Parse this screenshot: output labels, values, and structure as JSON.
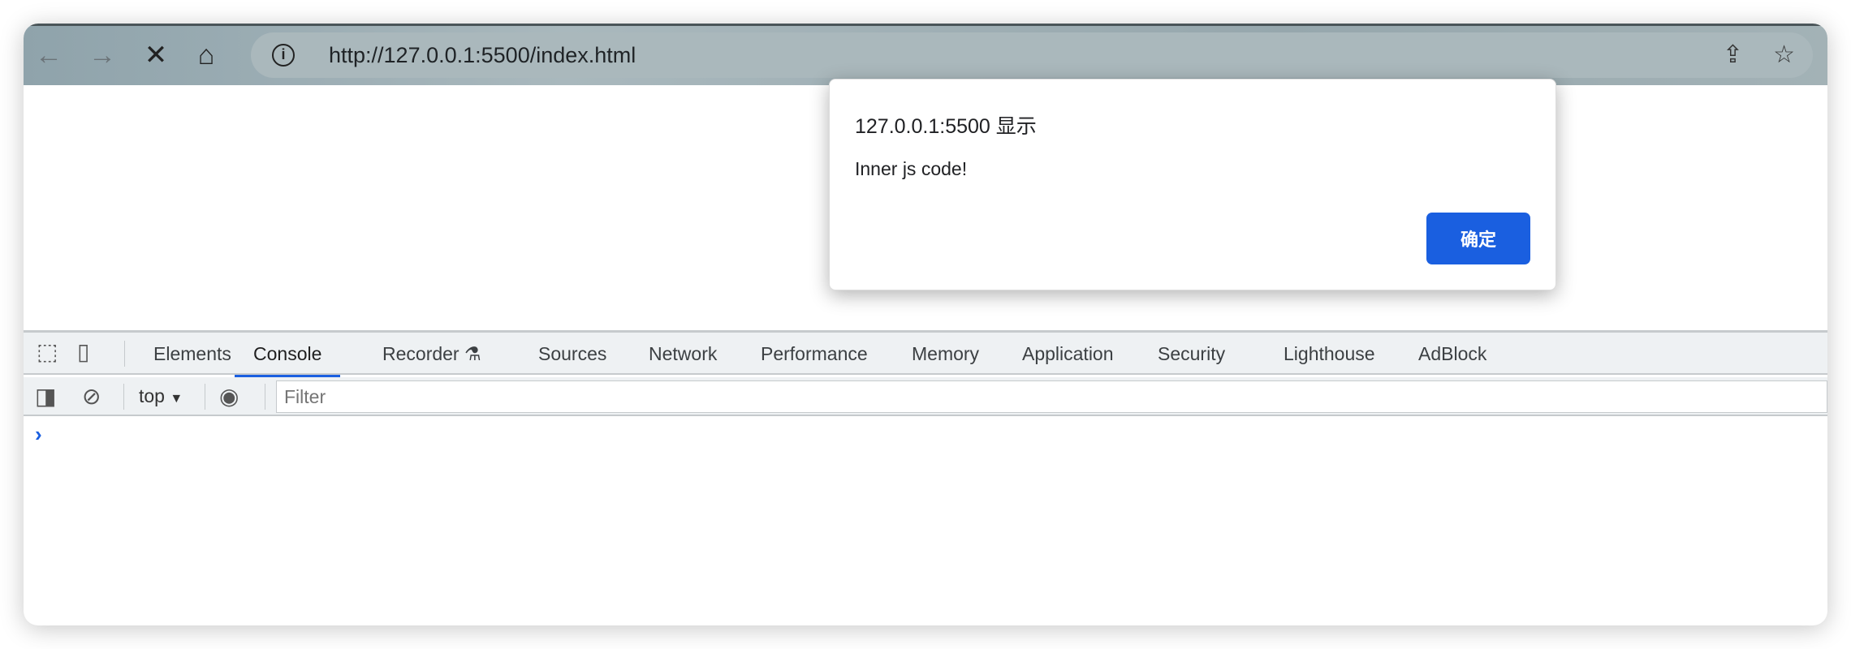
{
  "browser": {
    "url": "http://127.0.0.1:5500/index.html"
  },
  "dialog": {
    "title": "127.0.0.1:5500 显示",
    "message": "Inner js code!",
    "ok_label": "确定"
  },
  "devtools": {
    "tabs": [
      "Elements",
      "Console",
      "Recorder",
      "Sources",
      "Network",
      "Performance",
      "Memory",
      "Application",
      "Security",
      "Lighthouse",
      "AdBlock"
    ],
    "active_tab": "Console",
    "context": "top",
    "filter_placeholder": "Filter",
    "accent": "#1a5fe0"
  }
}
